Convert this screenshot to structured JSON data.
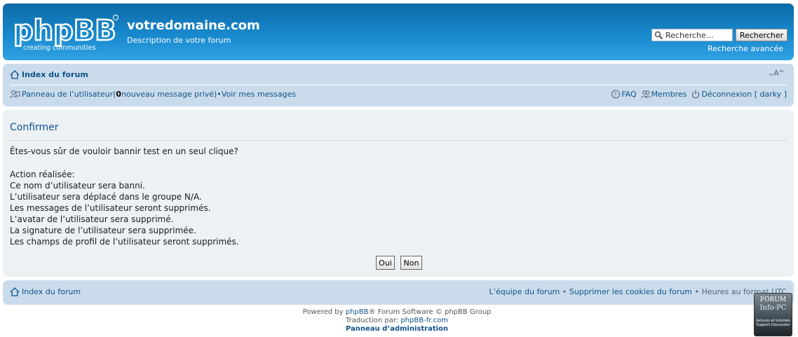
{
  "header": {
    "logo_text": "phpBB",
    "logo_tagline": "creating communities",
    "site_title": "votredomaine.com",
    "site_description": "Description de votre forum",
    "search_placeholder": "Recherche…",
    "search_button": "Rechercher",
    "advanced_search": "Recherche avancée"
  },
  "nav": {
    "forum_index": "Index du forum",
    "font_resize": "⌄A^",
    "user_panel": "Panneau de l’utilisateur",
    "pm_open": " (",
    "pm_count": "0",
    "pm_text": " nouveau message privé)",
    "bullet": " • ",
    "view_messages": "Voir mes messages",
    "faq": "FAQ",
    "members": "Membres",
    "logout": "Déconnexion [ darky ]"
  },
  "panel": {
    "title": "Confirmer",
    "question": "Êtes-vous sûr de vouloir bannir test en un seul clique?",
    "actions_heading": "Action réalisée:",
    "actions": [
      "Ce nom d’utilisateur sera banni.",
      "L’utilisateur sera déplacé dans le groupe N/A.",
      "Les messages de l’utilisateur seront supprimés.",
      "L’avatar de l’utilisateur sera supprimé.",
      "La signature de l’utilisateur sera supprimée.",
      "Les champs de profil de l’utilisateur seront supprimés."
    ],
    "yes_button": "Oui",
    "no_button": "Non"
  },
  "footer_nav": {
    "forum_index": "Index du forum",
    "team": "L’équipe du forum",
    "delete_cookies": "Supprimer les cookies du forum",
    "timezone": "Heures au format UTC",
    "bullet": " • "
  },
  "copyright": {
    "powered_prefix": "Powered by ",
    "phpbb_link": "phpBB",
    "powered_suffix": "® Forum Software © phpBB Group",
    "translation_prefix": "Traduction par: ",
    "translation_link": "phpBB-fr.com",
    "admin_panel": "Panneau d’administration"
  },
  "badge": {
    "line1": "FORUM",
    "line2": "Info-PC",
    "line3": "Astuces et tutoriels Support Discussion"
  }
}
